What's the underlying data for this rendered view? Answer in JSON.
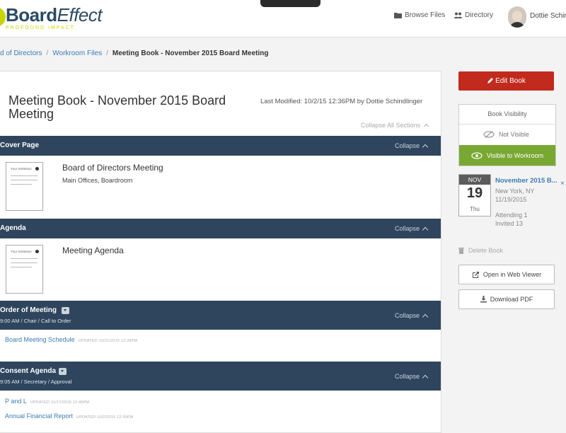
{
  "brand": {
    "name_bold": "Board",
    "name_italic": "Effect",
    "tagline": "PROFOUND IMPACT",
    "accent": "#c8d400"
  },
  "nav": {
    "browse_files": "Browse Files",
    "directory": "Directory",
    "user_name": "Dottie Schin"
  },
  "breadcrumb": {
    "items": [
      "d of Directors",
      "Workroom Files"
    ],
    "current": "Meeting Book - November 2015 Board Meeting",
    "separator": "/"
  },
  "book": {
    "title": "Meeting Book - November 2015 Board Meeting",
    "last_modified": "Last Modified: 10/2/15 12:36PM by Dottie Schindlinger",
    "collapse_all": "Collapse All Sections"
  },
  "sections": [
    {
      "title": "Cover Page",
      "collapse": "Collapse",
      "item_title": "Board of Directors Meeting",
      "item_sub": "Main Offices, Boardroom",
      "thumb_label": "Your Institution"
    },
    {
      "title": "Agenda",
      "collapse": "Collapse",
      "item_title": "Meeting Agenda",
      "thumb_label": "Your Institution"
    },
    {
      "title": "Order of Meeting",
      "sub": "9:00 AM / Chair / Call to Order",
      "collapse": "Collapse",
      "docs": [
        {
          "name": "Board Meeting Schedule",
          "updated": "UPDATED 10/21/2015 12:39PM"
        }
      ]
    },
    {
      "title": "Consent Agenda",
      "sub": "9:05 AM / Secretary / Approval",
      "collapse": "Collapse",
      "docs": [
        {
          "name": "P and L",
          "updated": "UPDATED 11/17/2015 12:40PM"
        },
        {
          "name": "Annual Financial Report",
          "updated": "UPDATED 10/2/2015 12:39PM"
        }
      ]
    }
  ],
  "sidebar": {
    "edit_book": "Edit Book",
    "visibility_label": "Book Visibility",
    "not_visible": "Not Visible",
    "visible_workroom": "Visible to Workroom",
    "event": {
      "month": "NOV",
      "day": "19",
      "dow": "Thu",
      "title": "November 2015 B...",
      "location": "New York, NY",
      "date": "11/19/2015",
      "attending": "Attending 1",
      "invited": "Invited 13",
      "close": "×"
    },
    "delete_book": "Delete Book",
    "open_web_viewer": "Open in Web Viewer",
    "download_pdf": "Download PDF"
  },
  "colors": {
    "section_bar": "#2e455d",
    "edit_button": "#c12a1c",
    "visible_green": "#78a832",
    "link": "#3c7bb5"
  }
}
